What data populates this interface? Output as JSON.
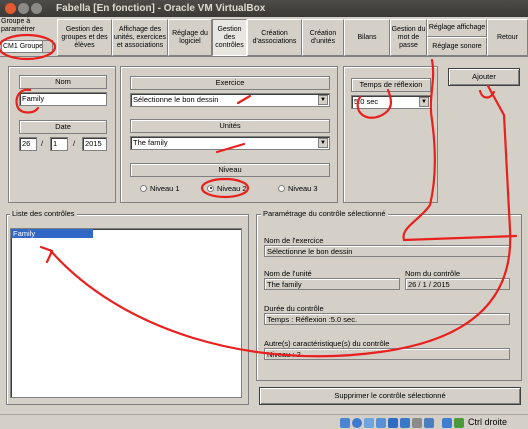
{
  "window": {
    "title": "Fabella [En fonction] - Oracle VM VirtualBox"
  },
  "toolbar": {
    "groupe_label": "Groupe à paramétrer",
    "groupe_value": "CM1 Groupe",
    "tabs": [
      {
        "label": "Gestion des groupes et des élèves"
      },
      {
        "label": "Affichage des unités, exercices et associations"
      },
      {
        "label": "Réglage du logiciel"
      },
      {
        "label": "Gestion des contrôles"
      },
      {
        "label": "Création d'associations"
      },
      {
        "label": "Création d'unités"
      },
      {
        "label": "Bilans"
      },
      {
        "label": "Gestion du mot de passe"
      },
      {
        "label_top": "Réglage affichage",
        "label_bottom": "Réglage sonore"
      },
      {
        "label": "Retour"
      }
    ]
  },
  "form": {
    "nom_header": "Nom",
    "nom_value": "Family",
    "date_header": "Date",
    "date_day": "26",
    "date_sep1": "/",
    "date_month": "1",
    "date_sep2": "/",
    "date_year": "2015",
    "exercice_header": "Exercice",
    "exercice_value": "Sélectionne le bon dessin",
    "unites_header": "Unités",
    "unites_value": "The family",
    "niveau_header": "Niveau",
    "niveau_options": [
      "Niveau 1",
      "Niveau 2",
      "Niveau 3"
    ],
    "niveau_selected": "Niveau 2",
    "temps_header": "Temps de réflexion",
    "temps_value": "5.0 sec",
    "ajouter_label": "Ajouter"
  },
  "liste": {
    "title": "Liste des contrôles",
    "items": [
      "Family"
    ]
  },
  "parametrage": {
    "title": "Paramétrage du contrôle sélectionné",
    "nom_exercice_label": "Nom de l'exercice",
    "nom_exercice_value": "Sélectionne le bon dessin",
    "nom_unite_label": "Nom de l'unité",
    "nom_unite_value": "The family",
    "nom_controle_label": "Nom du contrôle",
    "nom_controle_value": "26 / 1 / 2015",
    "duree_label": "Durée du contrôle",
    "duree_value": "Temps :     Réflexion :5.0 sec.",
    "autres_label": "Autre(s) caractéristique(s) du contrôle",
    "autres_value": "Niveau : 2",
    "supprimer_label": "Supprimer le contrôle sélectionné"
  },
  "statusbar": {
    "host_key": "Ctrl droite"
  },
  "annotation_color": "#e8201e"
}
